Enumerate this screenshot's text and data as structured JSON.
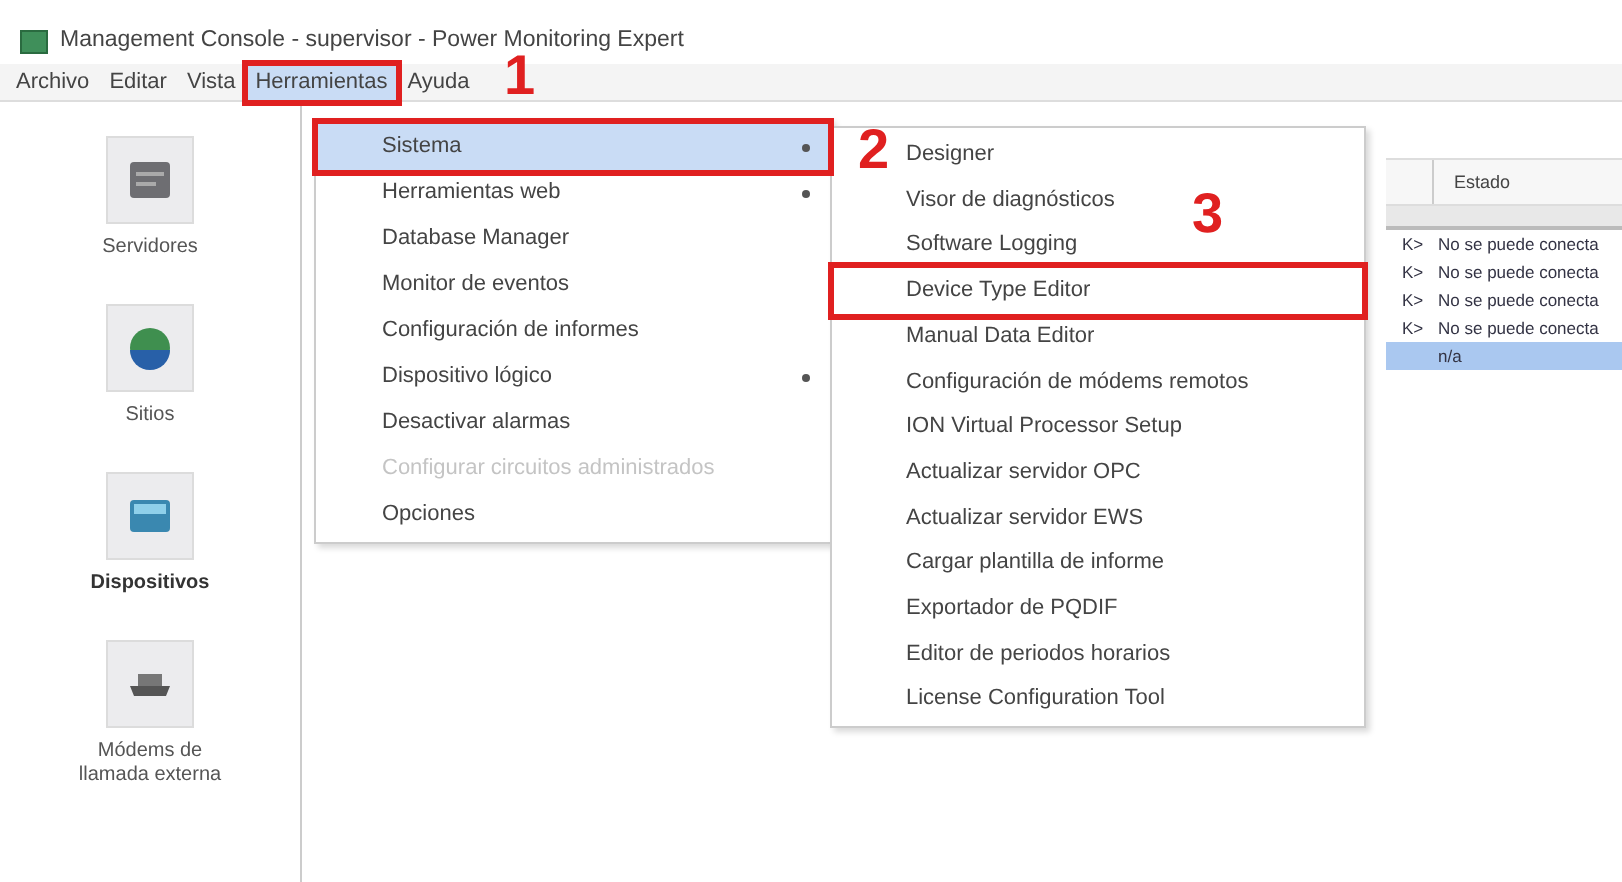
{
  "window": {
    "title": "Management Console - supervisor - Power Monitoring Expert"
  },
  "menu_bar": [
    {
      "label": "Archivo",
      "selected": false,
      "highlighted": false
    },
    {
      "label": "Editar",
      "selected": false,
      "highlighted": false
    },
    {
      "label": "Vista",
      "selected": false,
      "highlighted": false
    },
    {
      "label": "Herramientas",
      "selected": true,
      "highlighted": true
    },
    {
      "label": "Ayuda",
      "selected": false,
      "highlighted": false
    }
  ],
  "sidebar": {
    "items": [
      {
        "label": "Servidores",
        "selected": false,
        "kind": "server"
      },
      {
        "label": "Sitios",
        "selected": false,
        "kind": "globe"
      },
      {
        "label": "Dispositivos",
        "selected": true,
        "kind": "device"
      },
      {
        "label": "Módems de llamada externa",
        "selected": false,
        "kind": "modem"
      }
    ]
  },
  "tools_menu": {
    "items": [
      {
        "label": "Sistema",
        "selected": true,
        "submenu": true,
        "disabled": false,
        "highlighted": true
      },
      {
        "label": "Herramientas web",
        "selected": false,
        "submenu": true,
        "disabled": false,
        "highlighted": false
      },
      {
        "label": "Database Manager",
        "selected": false,
        "submenu": false,
        "disabled": false,
        "highlighted": false
      },
      {
        "label": "Monitor de eventos",
        "selected": false,
        "submenu": false,
        "disabled": false,
        "highlighted": false
      },
      {
        "label": "Configuración de informes",
        "selected": false,
        "submenu": false,
        "disabled": false,
        "highlighted": false
      },
      {
        "label": "Dispositivo lógico",
        "selected": false,
        "submenu": true,
        "disabled": false,
        "highlighted": false
      },
      {
        "label": "Desactivar alarmas",
        "selected": false,
        "submenu": false,
        "disabled": false,
        "highlighted": false
      },
      {
        "label": "Configurar circuitos administrados",
        "selected": false,
        "submenu": false,
        "disabled": true,
        "highlighted": false
      },
      {
        "label": "Opciones",
        "selected": false,
        "submenu": false,
        "disabled": false,
        "highlighted": false
      }
    ]
  },
  "system_submenu": {
    "items": [
      {
        "label": "Designer",
        "selected": false,
        "highlighted": false
      },
      {
        "label": "Visor de diagnósticos",
        "selected": false,
        "highlighted": false
      },
      {
        "label": "Software Logging",
        "selected": false,
        "highlighted": false
      },
      {
        "label": "Device Type Editor",
        "selected": false,
        "highlighted": true
      },
      {
        "label": "Manual Data Editor",
        "selected": false,
        "highlighted": false
      },
      {
        "label": "Configuración de módems remotos",
        "selected": false,
        "highlighted": false
      },
      {
        "label": "ION Virtual Processor Setup",
        "selected": false,
        "highlighted": false
      },
      {
        "label": "Actualizar servidor OPC",
        "selected": false,
        "highlighted": false
      },
      {
        "label": "Actualizar servidor EWS",
        "selected": false,
        "highlighted": false
      },
      {
        "label": "Cargar plantilla de informe",
        "selected": false,
        "highlighted": false
      },
      {
        "label": "Exportador de PQDIF",
        "selected": false,
        "highlighted": false
      },
      {
        "label": "Editor de periodos horarios",
        "selected": false,
        "highlighted": false
      },
      {
        "label": "License Configuration Tool",
        "selected": false,
        "highlighted": false
      }
    ]
  },
  "table": {
    "columns": [
      "Estado"
    ],
    "rows": [
      {
        "column_1": "K>",
        "estado": "No se puede conecta",
        "selected": false
      },
      {
        "column_1": "K>",
        "estado": "No se puede conecta",
        "selected": false
      },
      {
        "column_1": "K>",
        "estado": "No se puede conecta",
        "selected": false
      },
      {
        "column_1": "K>",
        "estado": "No se puede conecta",
        "selected": false
      },
      {
        "column_1": "",
        "estado": "n/a",
        "selected": true
      }
    ]
  },
  "annotations": [
    {
      "label": "1"
    },
    {
      "label": "2"
    },
    {
      "label": "3"
    }
  ]
}
